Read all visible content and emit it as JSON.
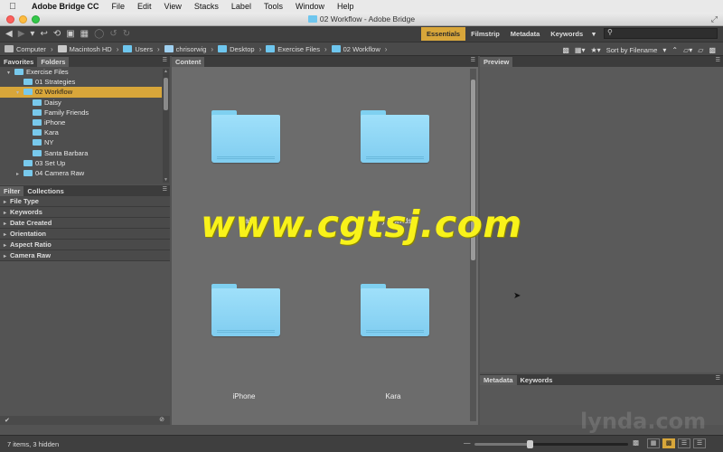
{
  "menubar": {
    "apple": "",
    "items": [
      "Adobe Bridge CC",
      "File",
      "Edit",
      "View",
      "Stacks",
      "Label",
      "Tools",
      "Window",
      "Help"
    ]
  },
  "window": {
    "title": "02 Workflow - Adobe Bridge"
  },
  "workspaces": {
    "items": [
      "Essentials",
      "Filmstrip",
      "Metadata",
      "Keywords"
    ],
    "active": "Essentials"
  },
  "search": {
    "placeholder": ""
  },
  "path": {
    "crumbs": [
      "Computer",
      "Macintosh HD",
      "Users",
      "chrisorwig",
      "Desktop",
      "Exercise Files",
      "02 Workflow"
    ]
  },
  "sort": {
    "label": "Sort by Filename"
  },
  "folders_panel": {
    "tabs": [
      "Favorites",
      "Folders"
    ],
    "rows": [
      {
        "label": "Exercise Files",
        "level": 1,
        "expanded": true
      },
      {
        "label": "01 Strategies",
        "level": 2
      },
      {
        "label": "02 Workflow",
        "level": 2,
        "expanded": true,
        "selected": true
      },
      {
        "label": "Daisy",
        "level": 3
      },
      {
        "label": "Family Friends",
        "level": 3
      },
      {
        "label": "iPhone",
        "level": 3
      },
      {
        "label": "Kara",
        "level": 3
      },
      {
        "label": "NY",
        "level": 3
      },
      {
        "label": "Santa Barbara",
        "level": 3
      },
      {
        "label": "03 Set Up",
        "level": 2
      },
      {
        "label": "04 Camera Raw",
        "level": 2,
        "collapsed": true
      }
    ]
  },
  "filter_panel": {
    "tabs": [
      "Filter",
      "Collections"
    ],
    "rows": [
      "File Type",
      "Keywords",
      "Date Created",
      "Orientation",
      "Aspect Ratio",
      "Camera Raw"
    ]
  },
  "content_panel": {
    "tab": "Content",
    "items": [
      {
        "label": "aisy"
      },
      {
        "label": "y Friends"
      },
      {
        "label": "iPhone"
      },
      {
        "label": "Kara"
      }
    ]
  },
  "preview_panel": {
    "tab": "Preview"
  },
  "metadata_panel": {
    "tabs": [
      "Metadata",
      "Keywords"
    ]
  },
  "watermark": {
    "text": "www.cgtsj.com",
    "corner": "lynda.com"
  },
  "status": {
    "text": "7 items, 3 hidden",
    "zoom_fraction": 0.36
  },
  "colors": {
    "accent": "#d8a63a",
    "folder": "#8fd6f5",
    "watermark": "#f8f21a"
  }
}
